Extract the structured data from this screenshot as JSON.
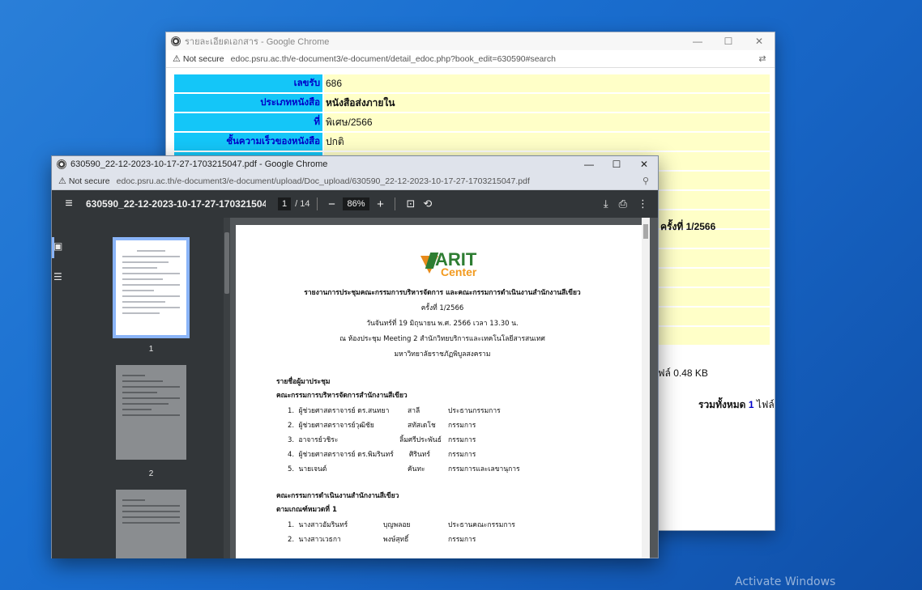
{
  "back_window": {
    "title": "รายละเอียดเอกสาร - Google Chrome",
    "controls": {
      "minimize": "—",
      "maximize": "☐",
      "close": "✕"
    },
    "not_secure": "Not secure",
    "url": "edoc.psru.ac.th/e-document3/e-document/detail_edoc.php?book_edit=630590#search",
    "rows": [
      {
        "label": "เลขรับ",
        "value": "686",
        "bold": false
      },
      {
        "label": "ประเภทหนังสือ",
        "value": "หนังสือส่งภายใน",
        "bold": true
      },
      {
        "label": "ที่",
        "value": "พิเศษ/2566",
        "bold": false
      },
      {
        "label": "ชั้นความเร็วของหนังสือ",
        "value": "ปกติ",
        "bold": false
      }
    ],
    "peek_subject": "ครั้งที่ 1/2566",
    "peek_file": "ไฟล์ 0.48 KB",
    "peek_total_label": "รวมทั้งหมด",
    "peek_total_count": "1",
    "peek_total_unit": "ไฟล์"
  },
  "front_window": {
    "title": "630590_22-12-2023-10-17-27-1703215047.pdf - Google Chrome",
    "controls": {
      "minimize": "—",
      "maximize": "☐",
      "close": "✕"
    },
    "not_secure": "Not secure",
    "url": "edoc.psru.ac.th/e-document3/e-document/upload/Doc_upload/630590_22-12-2023-10-17-27-1703215047.pdf",
    "pdf_toolbar": {
      "file_name": "630590_22-12-2023-10-17-27-1703215047....",
      "page_current": "1",
      "page_total": "/ 14",
      "zoom": "86%"
    },
    "thumbnails": [
      {
        "num": "1"
      },
      {
        "num": "2"
      }
    ],
    "document": {
      "logo_text_1": "ARIT",
      "logo_text_2": "Center",
      "title_line": "รายงานการประชุมคณะกรรมการบริหารจัดการ และคณะกรรมการดำเนินงานสำนักงานสีเขียว",
      "meeting_no": "ครั้งที่ 1/2566",
      "date_line": "วันจันทร์ที่ 19  มิถุนายน พ.ศ. 2566  เวลา 13.30 น.",
      "venue_line": "ณ ห้องประชุม Meeting  2 สำนักวิทยบริการและเทคโนโลยีสารสนเทศ",
      "uni_line": "มหาวิทยาลัยราชภัฏพิบูลสงคราม",
      "attendees_heading": "รายชื่อผู้มาประชุม",
      "committee1_heading": "คณะกรรมการบริหารจัดการสำนักงานสีเขียว",
      "committee1": [
        {
          "no": "1.",
          "name": "ผู้ช่วยศาสตราจารย์ ดร.สนทยา",
          "surname": "สาลี",
          "role": "ประธานกรรมการ"
        },
        {
          "no": "2.",
          "name": "ผู้ช่วยศาสตราจารย์วุฒิชัย",
          "surname": "สทัสเดโช",
          "role": "กรรมการ"
        },
        {
          "no": "3.",
          "name": "อาจารย์วชิระ",
          "surname": "ลิ้มศรีประพันธ์",
          "role": "กรรมการ"
        },
        {
          "no": "4.",
          "name": "ผู้ช่วยศาสตราจารย์ ดร.พิมรินทร์",
          "surname": "ศิรินทร์",
          "role": "กรรมการ"
        },
        {
          "no": "5.",
          "name": "นายเจนต์",
          "surname": "คันทะ",
          "role": "กรรมการและเลขานุการ"
        }
      ],
      "committee2_heading": "คณะกรรมการดำเนินงานสำนักงานสีเขียว",
      "category_heading": "ตามเกณฑ์หมวดที่ 1",
      "committee2": [
        {
          "no": "1.",
          "name": "นางสาวอัมรินทร์",
          "surname": "บุญพลอย",
          "role": "ประธานคณะกรรมการ"
        },
        {
          "no": "2.",
          "name": "นางสาวเวธกา",
          "surname": "พงษ์สุทธิ์",
          "role": "กรรมการ"
        }
      ]
    }
  },
  "desktop": {
    "watermark": "Activate Windows"
  }
}
